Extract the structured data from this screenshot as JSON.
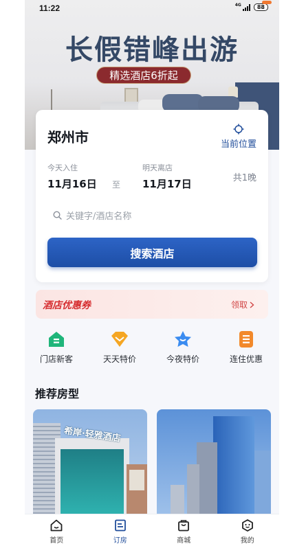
{
  "status_bar": {
    "time": "11:22",
    "network": "4G",
    "battery": "88"
  },
  "banner": {
    "title": "长假错峰出游",
    "subtitle": "精选酒店6折起"
  },
  "search": {
    "city": "郑州市",
    "locate_label": "当前位置",
    "checkin_label": "今天入住",
    "checkin_date": "11月16日",
    "to_label": "至",
    "checkout_label": "明天离店",
    "checkout_date": "11月17日",
    "nights": "共1晚",
    "keyword_placeholder": "关键字/酒店名称",
    "search_button": "搜索酒店"
  },
  "coupon": {
    "title": "酒店优惠券",
    "link": "领取"
  },
  "quick_entries": [
    {
      "label": "门店新客",
      "icon": "new-customer-icon"
    },
    {
      "label": "天天特价",
      "icon": "daily-deal-icon"
    },
    {
      "label": "今夜特价",
      "icon": "tonight-deal-icon"
    },
    {
      "label": "连住优惠",
      "icon": "multi-night-icon"
    }
  ],
  "section_title": "推荐房型",
  "rooms": [
    {
      "sign": "希岸·轻雅酒店"
    },
    {
      "sign": ""
    }
  ],
  "tabs": [
    {
      "label": "首页",
      "icon": "home-icon",
      "active": false
    },
    {
      "label": "订房",
      "icon": "booking-icon",
      "active": true
    },
    {
      "label": "商城",
      "icon": "shop-bag-icon",
      "active": false
    },
    {
      "label": "我的",
      "icon": "profile-icon",
      "active": false
    }
  ],
  "colors": {
    "brand_blue": "#1f4c9a",
    "button_blue": "#2559b8",
    "coupon_red": "#d62e30",
    "banner_red": "#8b2a2e"
  }
}
